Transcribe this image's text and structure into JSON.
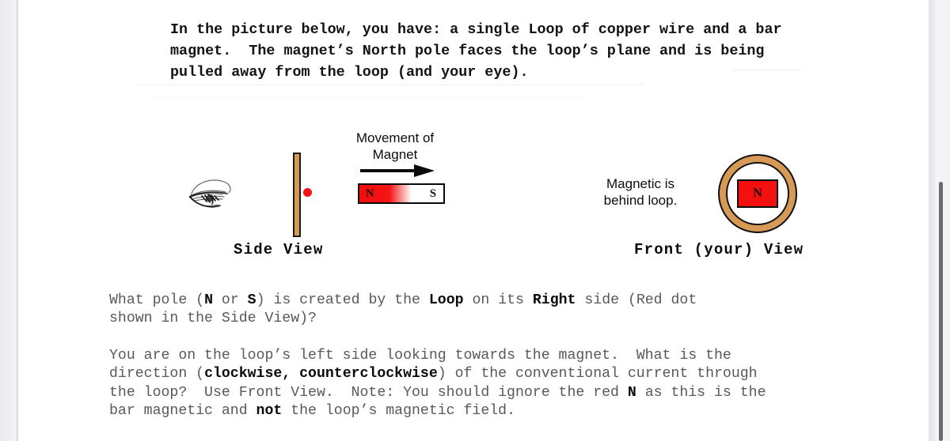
{
  "document": {
    "intro": "In the picture below, you have: a single Loop of copper wire and a bar\nmagnet.  The magnet’s North pole faces the loop’s plane and is being\npulled away from the loop (and your eye).",
    "questions": [
      {
        "id": "q-pole",
        "segments": [
          {
            "text": "What pole (",
            "bold": false
          },
          {
            "text": "N",
            "bold": true
          },
          {
            "text": " or ",
            "bold": false
          },
          {
            "text": "S",
            "bold": true
          },
          {
            "text": ") is created by the ",
            "bold": false
          },
          {
            "text": "Loop",
            "bold": true
          },
          {
            "text": " on its ",
            "bold": false
          },
          {
            "text": "Right",
            "bold": true
          },
          {
            "text": " side (Red dot\nshown in the Side View)?",
            "bold": false
          }
        ]
      },
      {
        "id": "q-current-direction",
        "segments": [
          {
            "text": "You are on the loop’s left side looking towards the magnet.  What is the\ndirection (",
            "bold": false
          },
          {
            "text": "clockwise, counterclockwise",
            "bold": true
          },
          {
            "text": ") of the conventional current through\nthe loop?  Use Front View.  Note: You should ignore the red ",
            "bold": false
          },
          {
            "text": "N",
            "bold": true
          },
          {
            "text": " as this is the\nbar magnetic and ",
            "bold": false
          },
          {
            "text": "not",
            "bold": true
          },
          {
            "text": " the loop’s magnetic field.",
            "bold": false
          }
        ]
      }
    ]
  },
  "diagram": {
    "side_view": {
      "caption": "Side View",
      "eye_icon": "eye-sketch-icon",
      "loop_edge_label": "copper-loop-edge",
      "red_dot_label": "red-dot-right-side",
      "movement_label": "Movement\nof Magnet",
      "arrow_icon": "arrow-right-icon",
      "magnet": {
        "north_label": "N",
        "south_label": "S",
        "north_color": "#f51414",
        "south_color": "#ffffff",
        "border_color": "#0a0a0a"
      }
    },
    "front_view": {
      "caption": "Front (your) View",
      "note": "Magnetic is\nbehind loop.",
      "ring_color": "#d79a56",
      "magnet_label": "N",
      "magnet_color": "#f51010"
    }
  },
  "chrome": {
    "scrollbar_name": "vertical-scrollbar",
    "scroll_thumb_color": "#6b6b72"
  }
}
